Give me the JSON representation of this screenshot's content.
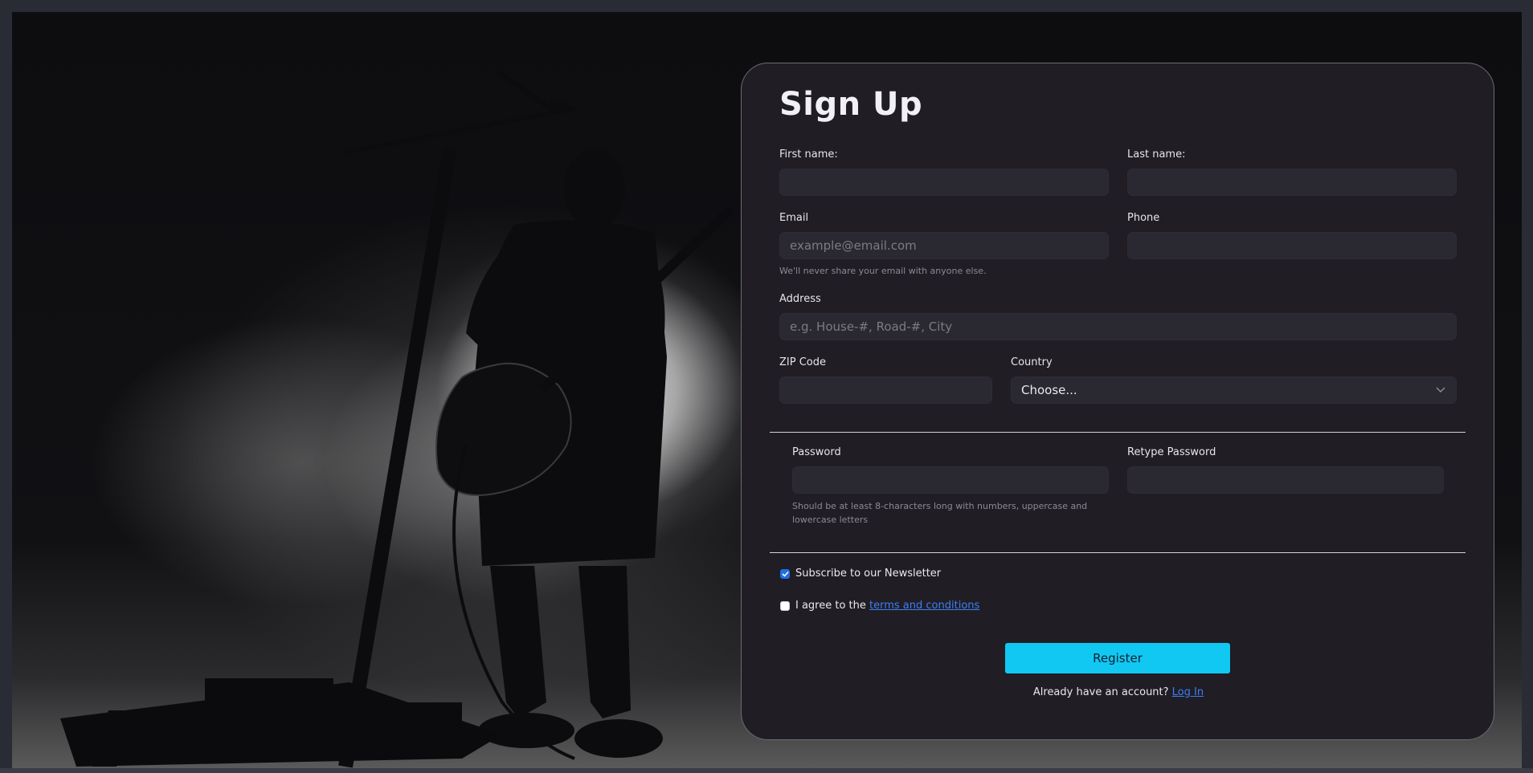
{
  "form": {
    "title": "Sign Up",
    "first_name": {
      "label": "First name:",
      "value": "",
      "placeholder": ""
    },
    "last_name": {
      "label": "Last name:",
      "value": "",
      "placeholder": ""
    },
    "email": {
      "label": "Email",
      "value": "",
      "placeholder": "example@email.com",
      "help": "We'll never share your email with anyone else."
    },
    "phone": {
      "label": "Phone",
      "value": "",
      "placeholder": ""
    },
    "address": {
      "label": "Address",
      "value": "",
      "placeholder": "e.g. House-#, Road-#, City"
    },
    "zip": {
      "label": "ZIP Code",
      "value": "",
      "placeholder": ""
    },
    "country": {
      "label": "Country",
      "selected": "Choose..."
    },
    "password": {
      "label": "Password",
      "value": "",
      "help": "Should be at least 8-characters long with numbers, uppercase and lowercase letters"
    },
    "retype_password": {
      "label": "Retype Password",
      "value": ""
    },
    "newsletter": {
      "label": "Subscribe to our Newsletter",
      "checked": true
    },
    "terms": {
      "label_prefix": "I agree to the ",
      "link_text": "terms and conditions",
      "checked": false
    },
    "register_label": "Register",
    "login_prompt": "Already have an account? ",
    "login_link": "Log In"
  },
  "colors": {
    "accent": "#11c8f2",
    "link": "#3d7ff0",
    "card_bg": "#201d25",
    "checkbox": "#1f6fe5"
  },
  "icons": {
    "select_caret": "chevron-down-icon",
    "check": "checkmark-icon"
  }
}
